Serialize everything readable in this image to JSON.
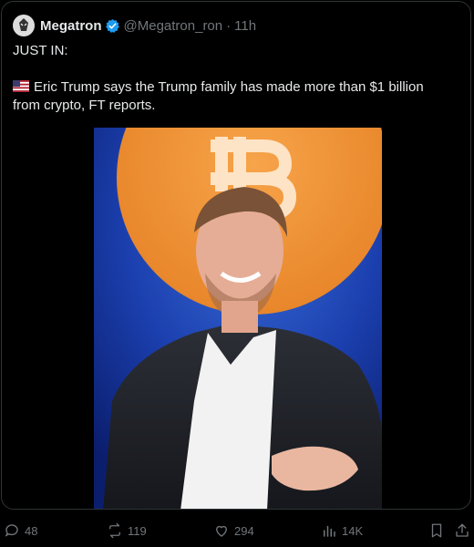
{
  "tweet": {
    "author_name": "Megatron",
    "handle": "@Megatron_ron",
    "separator": "·",
    "time": "11h",
    "text_line1": "JUST IN:",
    "text_line2": "Eric Trump says the Trump family has made more than $1 billion",
    "text_line3": "from crypto, FT reports."
  },
  "actions": {
    "replies": "48",
    "reposts": "119",
    "likes": "294",
    "views": "14K"
  },
  "icons": {
    "verified": "verified-badge-icon",
    "flag": "us-flag-icon",
    "reply": "reply-icon",
    "repost": "repost-icon",
    "like": "heart-icon",
    "views": "views-icon",
    "bookmark": "bookmark-icon",
    "share": "share-icon"
  },
  "colors": {
    "background": "#000000",
    "text": "#e7e9ea",
    "muted": "#71767b",
    "verified": "#1d9bf0",
    "border": "#2f3336"
  }
}
